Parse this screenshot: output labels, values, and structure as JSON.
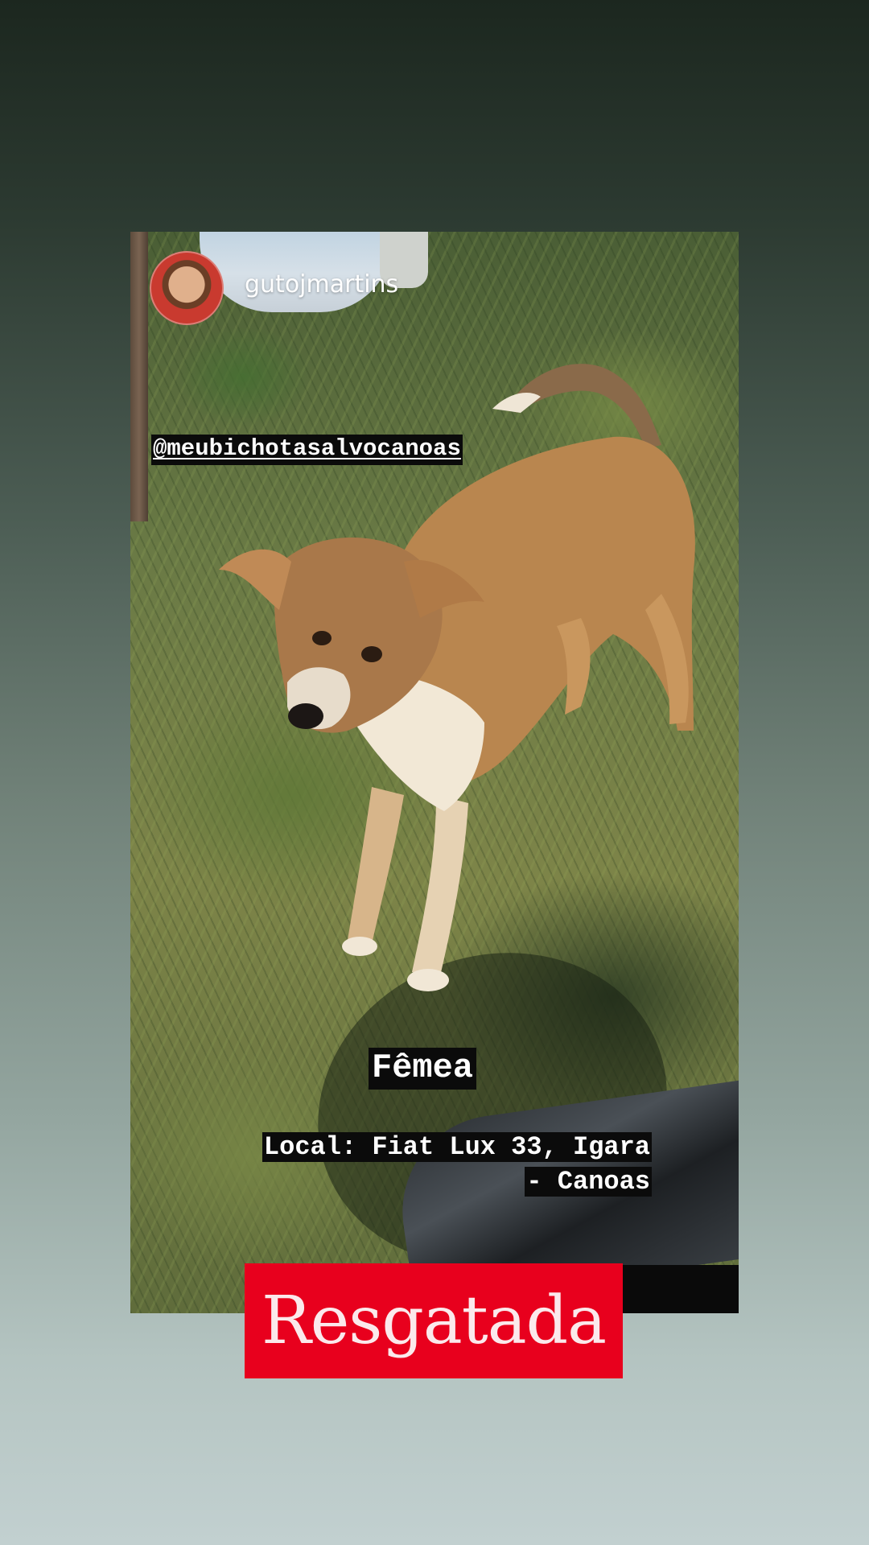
{
  "story": {
    "username": "gutojmartins",
    "avatar_icon": "user-avatar",
    "mention": "@meubichotasalvocanoas",
    "sex_label": "Fêmea",
    "location_line1": "Local: Fiat Lux 33, Igara",
    "location_line2": "- Canoas",
    "banner_text": "Resgatada"
  },
  "colors": {
    "banner_red": "#e8001d",
    "label_background": "#0b0b0b",
    "label_text": "#ffffff"
  }
}
